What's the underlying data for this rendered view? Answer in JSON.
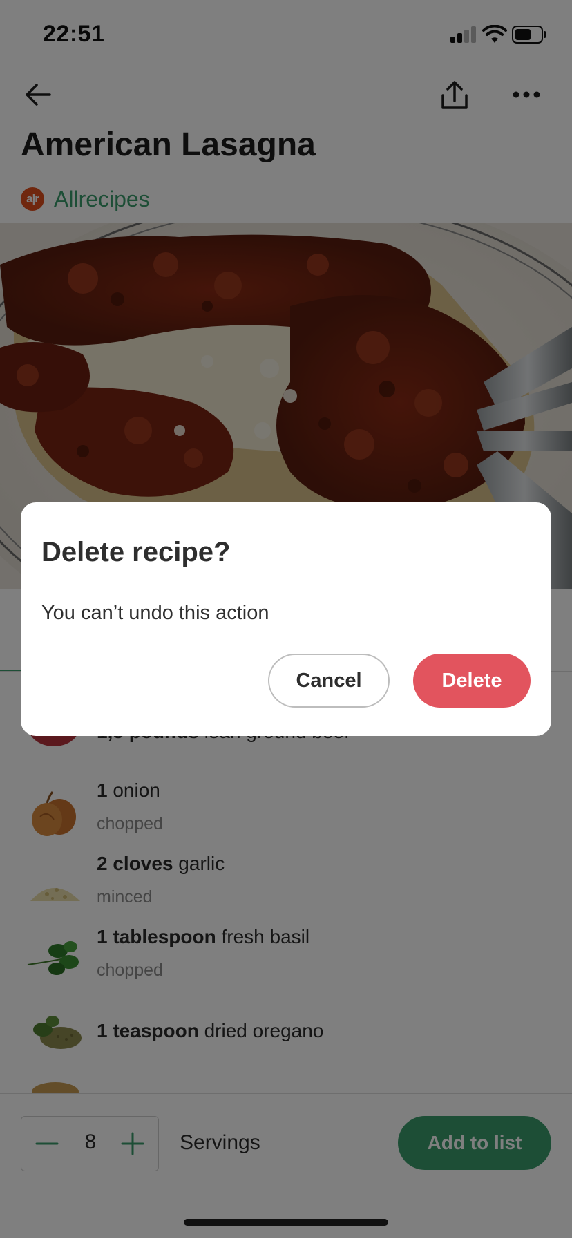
{
  "status_bar": {
    "time": "22:51"
  },
  "recipe": {
    "title": "American Lasagna",
    "source": {
      "logo_text": "a|r",
      "name": "Allrecipes"
    }
  },
  "ingredients": [
    {
      "qty": "1,5 pounds",
      "name": " lean ground beef",
      "note": ""
    },
    {
      "qty": "1",
      "name": " onion",
      "note": "chopped"
    },
    {
      "qty": "2 cloves",
      "name": " garlic",
      "note": "minced"
    },
    {
      "qty": "1  tablespoon",
      "name": " fresh basil",
      "note": "chopped"
    },
    {
      "qty": "1  teaspoon",
      "name": " dried oregano",
      "note": ""
    }
  ],
  "bottom_bar": {
    "servings_value": "8",
    "servings_label": "Servings",
    "add_to_list_label": "Add to list"
  },
  "dialog": {
    "title": "Delete recipe?",
    "message": "You can’t undo this action",
    "cancel_label": "Cancel",
    "delete_label": "Delete"
  },
  "colors": {
    "accent_green": "#3b9c6d",
    "delete_red": "#e2545e",
    "overlay": "rgba(0,0,0,0.5)",
    "source_logo": "#e04e1c"
  },
  "icons": [
    "back-arrow-icon",
    "share-icon",
    "more-icon",
    "minus-icon",
    "plus-icon",
    "wifi-icon",
    "cellular-signal-icon",
    "battery-icon"
  ]
}
